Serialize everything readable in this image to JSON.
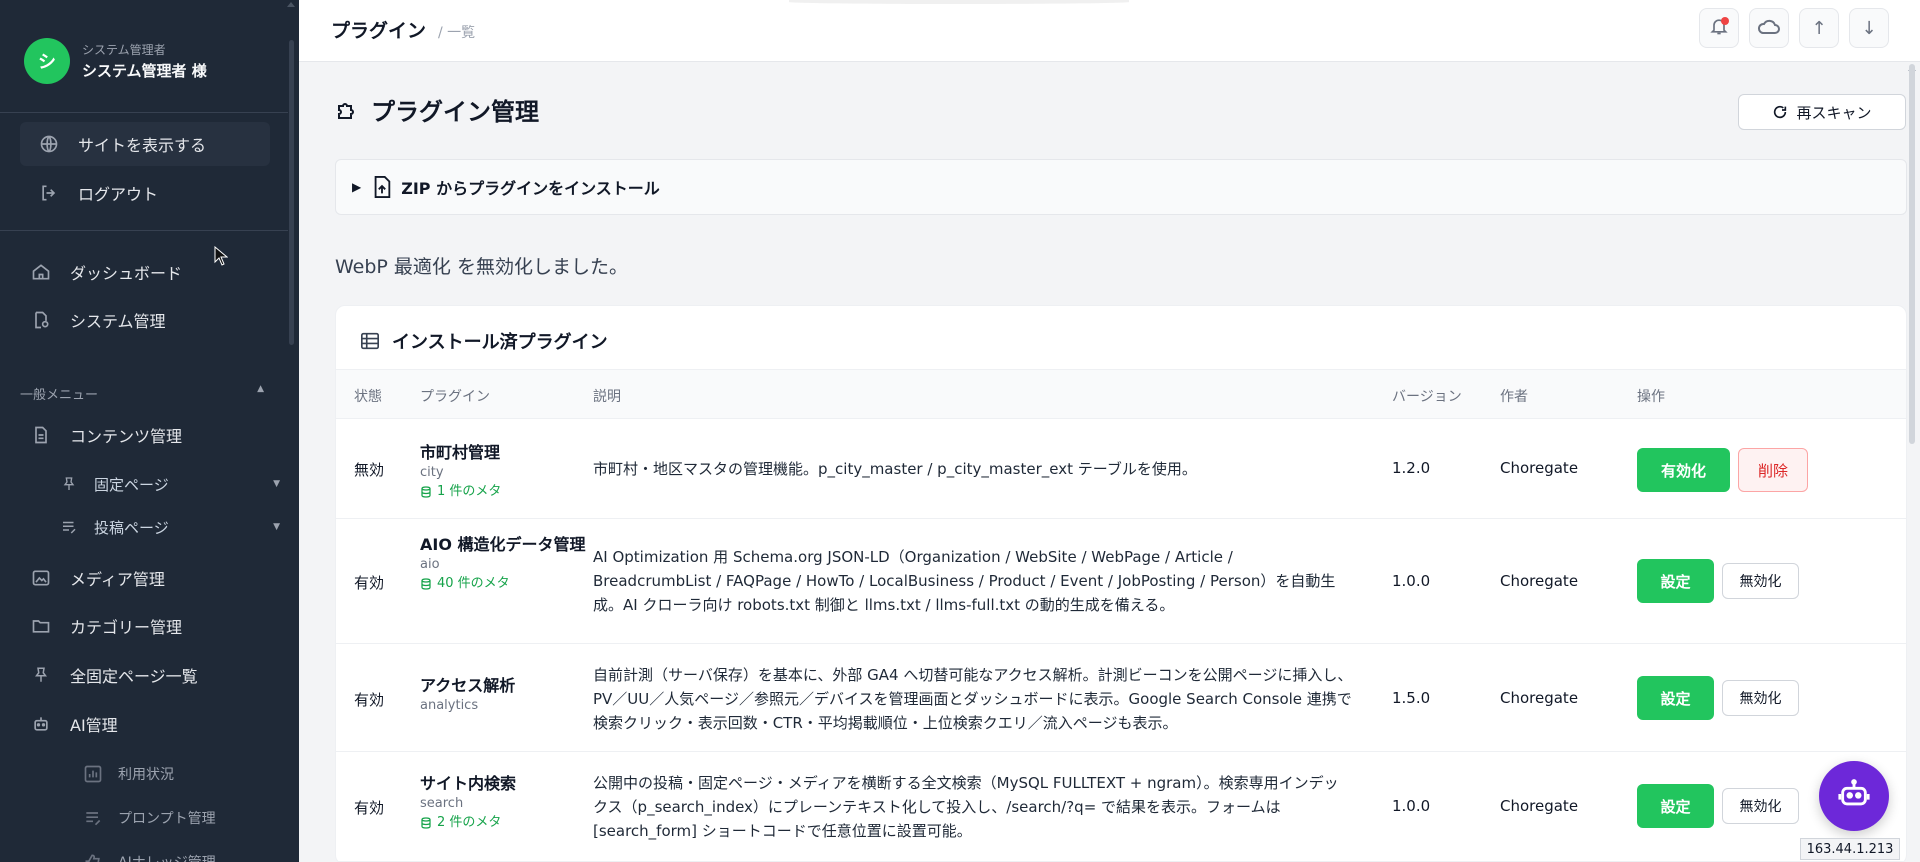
{
  "user": {
    "avatar_initial": "シ",
    "role": "システム管理者",
    "name": "システム管理者 様"
  },
  "sidebar": {
    "top_items": [
      {
        "label": "サイトを表示する",
        "icon": "globe-icon"
      },
      {
        "label": "ログアウト",
        "icon": "logout-icon"
      }
    ],
    "main_items": [
      {
        "label": "ダッシュボード",
        "icon": "home-icon"
      },
      {
        "label": "システム管理",
        "icon": "system-icon"
      }
    ],
    "section_label": "一般メニュー",
    "content_items": [
      {
        "label": "コンテンツ管理",
        "icon": "document-icon"
      },
      {
        "label": "固定ページ",
        "icon": "pin-icon"
      },
      {
        "label": "投稿ページ",
        "icon": "post-icon"
      },
      {
        "label": "メディア管理",
        "icon": "image-icon"
      },
      {
        "label": "カテゴリー管理",
        "icon": "folder-icon"
      },
      {
        "label": "全固定ページ一覧",
        "icon": "pin-icon"
      },
      {
        "label": "AI管理",
        "icon": "robot-icon"
      },
      {
        "label": "利用状況",
        "icon": "chart-icon"
      },
      {
        "label": "プロンプト管理",
        "icon": "prompt-icon"
      },
      {
        "label": "AIナレッジ管理",
        "icon": "knowledge-icon"
      }
    ]
  },
  "topbar": {
    "title": "プラグイン",
    "subtitle": "/ 一覧"
  },
  "page": {
    "title": "プラグイン管理",
    "rescan_label": "再スキャン",
    "zip_label": "ZIP からプラグインをインストール",
    "flash": "WebP 最適化 を無効化しました。"
  },
  "table": {
    "title": "インストール済プラグイン",
    "headers": {
      "status": "状態",
      "plugin": "プラグイン",
      "description": "説明",
      "version": "バージョン",
      "author": "作者",
      "actions": "操作"
    },
    "rows": [
      {
        "status": "無効",
        "name": "市町村管理",
        "slug": "city",
        "meta": "1 件のメタ",
        "description": "市町村・地区マスタの管理機能。p_city_master / p_city_master_ext テーブルを使用。",
        "version": "1.2.0",
        "author": "Choregate",
        "primary": "有効化",
        "secondary": "削除"
      },
      {
        "status": "有効",
        "name": "AIO 構造化データ管理",
        "slug": "aio",
        "meta": "40 件のメタ",
        "description": "AI Optimization 用 Schema.org JSON-LD（Organization / WebSite / WebPage / Article / BreadcrumbList / FAQPage / HowTo / LocalBusiness / Product / Event / JobPosting / Person）を自動生成。AI クローラ向け robots.txt 制御と llms.txt / llms-full.txt の動的生成を備える。",
        "version": "1.0.0",
        "author": "Choregate",
        "primary": "設定",
        "secondary": "無効化"
      },
      {
        "status": "有効",
        "name": "アクセス解析",
        "slug": "analytics",
        "meta": "",
        "description": "自前計測（サーバ保存）を基本に、外部 GA4 へ切替可能なアクセス解析。計測ビーコンを公開ページに挿入し、PV／UU／人気ページ／参照元／デバイスを管理画面とダッシュボードに表示。Google Search Console 連携で検索クリック・表示回数・CTR・平均掲載順位・上位検索クエリ／流入ページも表示。",
        "version": "1.5.0",
        "author": "Choregate",
        "primary": "設定",
        "secondary": "無効化"
      },
      {
        "status": "有効",
        "name": "サイト内検索",
        "slug": "search",
        "meta": "2 件のメタ",
        "description": "公開中の投稿・固定ページ・メディアを横断する全文検索（MySQL FULLTEXT + ngram）。検索専用インデックス（p_search_index）にプレーンテキスト化して投入し、/search/?q= で結果を表示。フォームは [search_form] ショートコードで任意位置に設置可能。",
        "version": "1.0.0",
        "author": "Choregate",
        "primary": "設定",
        "secondary": "無効化"
      }
    ]
  },
  "footer": {
    "ip": "163.44.1.213"
  },
  "colors": {
    "sidebar_bg": "#1f2937",
    "accent_green": "#22c55e",
    "danger": "#dc2626",
    "fab": "#6d28d9"
  }
}
